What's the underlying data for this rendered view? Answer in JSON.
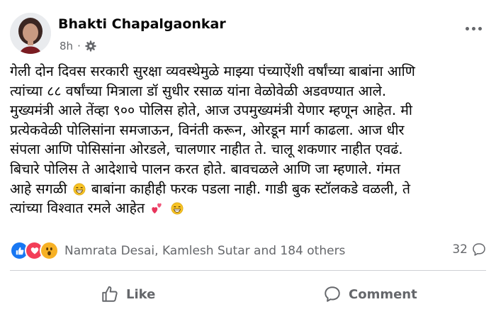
{
  "post": {
    "author": "Bhakti Chapalgaonkar",
    "time": "8h",
    "visibility_icon": "gear-icon",
    "lines": [
      "गेली दोन दिवस सरकारी सुरक्षा व्यवस्थेमुळे माझ्या पंच्याऐंशी वर्षांच्या बाबांना आणि",
      "त्यांच्या ८८ वर्षांच्या मित्राला डॉ सुधीर रसाळ यांना वेळोवेळी अडवण्यात आले.",
      "मुख्यमंत्री आले तेंव्हा ९०० पोलिस होते, आज  उपमुख्यमंत्री येणार म्हणून आहेत. मी",
      "प्रत्येकवेळी पोलिसांना समजाऊन, विनंती करून, ओरडून मार्ग काढला. आज धीर",
      "संपला आणि पोसिसांना ओरडले, चालणार नाहीत ते. चालू शकणार नाहीत एवढं.",
      "बिचारे पोलिस ते आदेशाचे पालन करत होते. बावचळले आणि जा म्हणाले. गंमत"
    ],
    "line7_part1": "आहे सगळी",
    "line7_part2": "बाबांना काहीही फरक पडला नाही. गाडी बुक स्टॉलकडे वळली, ते",
    "line8": "त्यांच्या विश्वात रमले आहेत"
  },
  "reactions": {
    "types": [
      "like",
      "love",
      "wow"
    ],
    "names": "Namrata Desai, Kamlesh Sutar and 184 others",
    "comment_count": "32"
  },
  "actions": {
    "like_label": "Like",
    "comment_label": "Comment"
  },
  "colors": {
    "secondary_text": "#65676b",
    "like_blue": "#1877f2",
    "love_red": "#f33e58",
    "wow_yellow": "#f7b125"
  }
}
